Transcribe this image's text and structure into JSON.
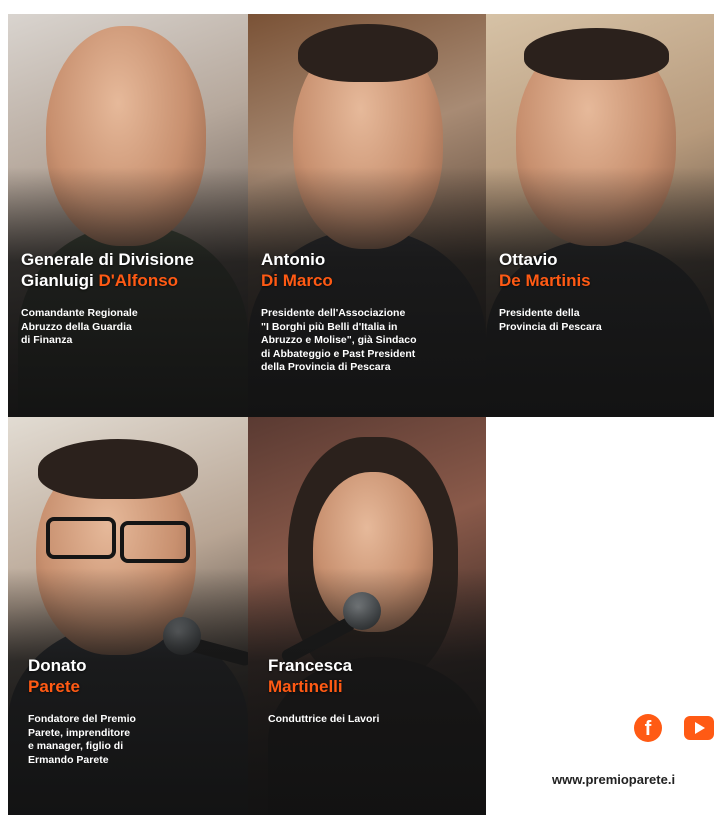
{
  "speakers": [
    {
      "first_name": "Generale di Divisione",
      "last_name_line": "Gianluigi ",
      "last_name": "D'Alfonso",
      "role": "Comandante Regionale\nAbruzzo della Guardia\ndi Finanza"
    },
    {
      "first_name": "Antonio",
      "last_name": "Di Marco",
      "role": "Presidente dell'Associazione\n\"I Borghi più Belli d'Italia in\nAbruzzo e Molise\", già Sindaco\ndi Abbateggio e Past President\ndella Provincia di Pescara"
    },
    {
      "first_name": "Ottavio",
      "last_name": "De Martinis",
      "role": "Presidente della\nProvincia di Pescara"
    },
    {
      "first_name": "Donato",
      "last_name": "Parete",
      "role": "Fondatore del Premio\nParete, imprenditore\ne manager, figlio di\nErmando Parete"
    },
    {
      "first_name": "Francesca",
      "last_name": "Martinelli",
      "role": "Conduttrice dei Lavori"
    }
  ],
  "footer": {
    "website": "www.premioparete.i",
    "facebook_icon": "facebook-icon",
    "youtube_icon": "youtube-icon"
  },
  "colors": {
    "accent": "#ff5a14",
    "text_light": "#ffffff",
    "text_dark": "#222222"
  }
}
